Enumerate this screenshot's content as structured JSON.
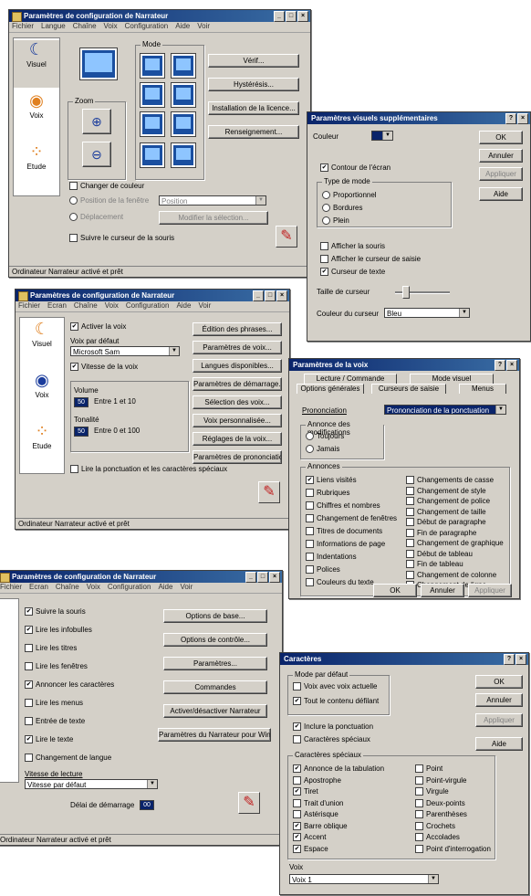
{
  "w1": {
    "title": "Paramètres de configuration de Narrateur",
    "menu": [
      "Fichier",
      "Langue",
      "Chaîne",
      "Voix",
      "Configuration",
      "Aide",
      "Voir"
    ],
    "side": [
      "Visuel",
      "Voix",
      "Etude"
    ],
    "group_mode": "Mode",
    "group_zoom": "Zoom",
    "buttons": [
      "Vérif...",
      "Hystérésis...",
      "Installation de la licence...",
      "Renseignement..."
    ],
    "chk_calque": "Changer de couleur",
    "rad_fixe": "Position de la fenêtre",
    "rad_pres": "Déplacement",
    "combo_val": "Position",
    "btn_mod": "Modifier la sélection...",
    "chk_suivre": "Suivre le curseur de la souris",
    "status": "Ordinateur Narrateur activé et prêt"
  },
  "w2": {
    "title": "Paramètres visuels supplémentaires",
    "lbl_couleur": "Couleur",
    "chk_contour": "Contour de l'écran",
    "group_type": "Type de mode",
    "rad": [
      "Proportionnel",
      "Bordures",
      "Plein"
    ],
    "chk": [
      "Afficher la souris",
      "Afficher le curseur de saisie",
      "Curseur de texte"
    ],
    "lbl_taille": "Taille de curseur",
    "lbl_couleur_curseur": "Couleur du curseur",
    "combo_val": "Bleu",
    "buttons": [
      "OK",
      "Annuler",
      "Appliquer",
      "Aide"
    ]
  },
  "w3": {
    "title": "Paramètres de configuration de Narrateur",
    "menu": [
      "Fichier",
      "Ecran",
      "Chaîne",
      "Voix",
      "Configuration",
      "Aide",
      "Voir"
    ],
    "side": [
      "Visuel",
      "Voix",
      "Etude"
    ],
    "chk_auto": "Activer la voix",
    "lbl_voix": "Voix par défaut",
    "combo_val": "Microsoft Sam",
    "chk_vitesse": "Vitesse de la voix",
    "lbl_vol": "Volume",
    "vol_val": "50",
    "vol_range": "Entre 1 et 10",
    "lbl_tonalite": "Tonalité",
    "ton_val": "50",
    "ton_range": "Entre 0 et 100",
    "buttons": [
      "Édition des phrases...",
      "Paramètres de voix...",
      "Langues disponibles...",
      "Paramètres de démarrage...",
      "Sélection des voix...",
      "Voix personnalisée...",
      "Réglages de la voix...",
      "Paramètres de prononciation..."
    ],
    "chk_bottom": "Lire la ponctuation et les caractères spéciaux",
    "status": "Ordinateur Narrateur activé et prêt"
  },
  "w4": {
    "title": "Paramètres de la voix",
    "tabs_top": [
      "Lecture / Commande",
      "Mode visuel"
    ],
    "tabs_bottom": [
      "Options générales",
      "Curseurs de saisie",
      "Menus"
    ],
    "lbl_prononcer": "Prononciation",
    "combo_val": "Prononciation de la ponctuation",
    "group_ann": "Annonce des modifications",
    "rad": [
      "Toujours",
      "Jamais"
    ],
    "group_ann2": "Annonces",
    "left": [
      "Liens visités",
      "Rubriques",
      "Chiffres et nombres",
      "Changement de fenêtres",
      "Titres de documents",
      "Informations de page",
      "Indentations",
      "Polices",
      "Couleurs du texte"
    ],
    "left_checked": [
      true,
      false,
      false,
      false,
      false,
      false,
      false,
      false,
      false
    ],
    "right": [
      "Changements de casse",
      "Changement de style",
      "Changement de police",
      "Changement de taille",
      "Début de paragraphe",
      "Fin de paragraphe",
      "Changement de graphique",
      "Début de tableau",
      "Fin de tableau",
      "Changement de colonne",
      "Changement de ligne"
    ],
    "buttons": [
      "OK",
      "Annuler",
      "Appliquer"
    ]
  },
  "w5": {
    "title": "Paramètres de configuration de Narrateur",
    "menu": [
      "Fichier",
      "Ecran",
      "Chaîne",
      "Voix",
      "Configuration",
      "Aide",
      "Voir"
    ],
    "chk": [
      "Suivre la souris",
      "Lire les infobulles",
      "Lire les titres",
      "Lire les fenêtres",
      "Annoncer les caractères",
      "Lire les menus",
      "Entrée de texte",
      "Lire le texte",
      "Changement de langue"
    ],
    "chk_checked": [
      true,
      true,
      false,
      false,
      true,
      false,
      false,
      true,
      false
    ],
    "lbl_vitesse": "Vitesse de lecture",
    "combo_val": "Vitesse par défaut",
    "lbl_delai": "Délai de démarrage",
    "delai_val": "00",
    "buttons": [
      "Options de base...",
      "Options de contrôle...",
      "Paramètres...",
      "Commandes",
      "Activer/désactiver Narrateur",
      "Paramètres du Narrateur pour Windows..."
    ],
    "status": "Ordinateur Narrateur activé et prêt"
  },
  "w6": {
    "title": "Caractères",
    "group_mode": "Mode par défaut",
    "chk_top": [
      "Voix avec voix actuelle",
      "Tout le contenu défilant"
    ],
    "chk_top_checked": [
      false,
      true
    ],
    "chk_mid": [
      "Inclure la ponctuation",
      "Caractères spéciaux"
    ],
    "chk_mid_checked": [
      true,
      false
    ],
    "group_lire": "Caractères spéciaux",
    "left": [
      "Annonce de la tabulation",
      "Apostrophe",
      "Tiret",
      "Trait d'union",
      "Astérisque",
      "Barre oblique",
      "Accent",
      "Espace"
    ],
    "left_checked": [
      true,
      false,
      true,
      false,
      false,
      true,
      true,
      true
    ],
    "right": [
      "Point",
      "Point-virgule",
      "Virgule",
      "Deux-points",
      "Parenthèses",
      "Crochets",
      "Accolades",
      "Point d'interrogation"
    ],
    "lbl_voix": "Voix",
    "combo_val": "Voix 1",
    "buttons": [
      "OK",
      "Annuler",
      "Appliquer",
      "Aide"
    ]
  }
}
